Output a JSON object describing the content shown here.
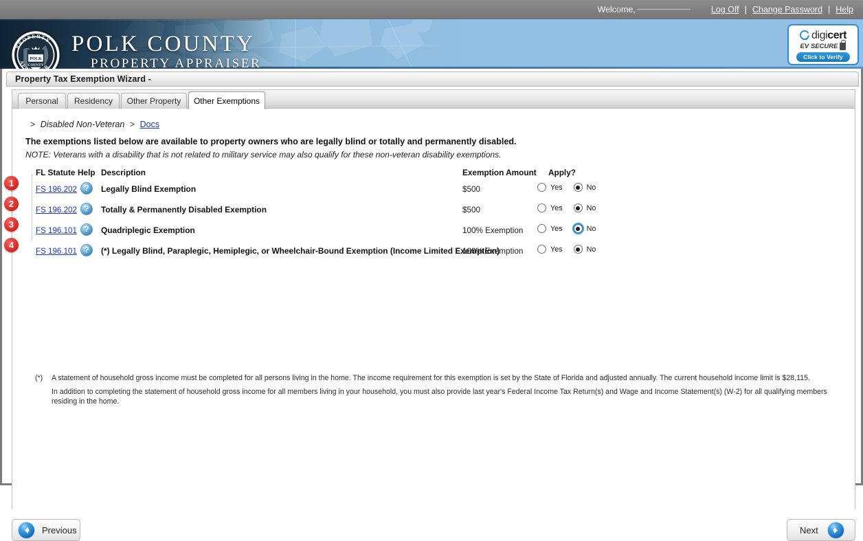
{
  "topbar": {
    "welcome_label": "Welcome,",
    "log_off": "Log Off",
    "change_password": "Change Password",
    "help": "Help",
    "separator": "|"
  },
  "banner": {
    "seal_text_top": "PROPERTY",
    "seal_text_bottom": "APPRAISER",
    "seal_center_line1": "POLK",
    "seal_center_line2": "COUNTY",
    "title_main": "POLK COUNTY",
    "title_sub": "PROPERTY APPRAISER",
    "digicert": {
      "brand_light": "digi",
      "brand_bold": "cert",
      "subtitle": "EV SECURE",
      "verify": "Click to Verify"
    }
  },
  "window": {
    "title": "Property Tax Exemption Wizard -"
  },
  "tabs": [
    {
      "label": "Personal",
      "active": false
    },
    {
      "label": "Residency",
      "active": false
    },
    {
      "label": "Other Property",
      "active": false
    },
    {
      "label": "Other Exemptions",
      "active": true
    }
  ],
  "breadcrumb": {
    "chevron": ">",
    "section": "Disabled Non-Veteran",
    "docs_link": "Docs"
  },
  "main": {
    "lead": "The exemptions listed below are available to property owners who are legally blind or totally and permanently disabled.",
    "note": "NOTE: Veterans with a disability that is not related to military service may also qualify for these non-veteran disability exemptions.",
    "columns": {
      "statute": "FL Statute",
      "help": "Help",
      "description": "Description",
      "amount": "Exemption Amount",
      "apply": "Apply?"
    },
    "radio_labels": {
      "yes": "Yes",
      "no": "No"
    },
    "help_glyph": "?",
    "rows": [
      {
        "badge": "1",
        "statute": "FS 196.202",
        "description": "Legally Blind Exemption",
        "amount": "$500",
        "apply_yes": false,
        "apply_no": true,
        "focused": false
      },
      {
        "badge": "2",
        "statute": "FS 196.202",
        "description": "Totally & Permanently Disabled Exemption",
        "amount": "$500",
        "apply_yes": false,
        "apply_no": true,
        "focused": false
      },
      {
        "badge": "3",
        "statute": "FS 196.101",
        "description": "Quadriplegic Exemption",
        "amount": "100% Exemption",
        "apply_yes": false,
        "apply_no": true,
        "focused": true
      },
      {
        "badge": "4",
        "statute": "FS 196.101",
        "description": "(*) Legally Blind, Paraplegic, Hemiplegic, or Wheelchair-Bound Exemption (Income Limited Exemption)",
        "amount": "100% Exemption",
        "apply_yes": false,
        "apply_no": true,
        "focused": false
      }
    ],
    "footnote_marker": "(*)",
    "footnote_line1": "A statement of household gross income must be completed for all persons living in the home. The income requirement for this exemption is set by the State of Florida and adjusted annually. The current household income limit is $28,115.",
    "footnote_line2": "In addition to completing the statement of household gross income for all members living in your household, you must also provide last year's Federal Income Tax Return(s) and Wage and Income Statement(s) (W-2) for all qualifying members residing in the home."
  },
  "footer": {
    "previous": "Previous",
    "next": "Next"
  },
  "colors": {
    "link": "#1a37c8",
    "badge_red": "#df2f2b",
    "accent_blue": "#2b8fd6",
    "focus_ring": "#2aa3e8"
  }
}
